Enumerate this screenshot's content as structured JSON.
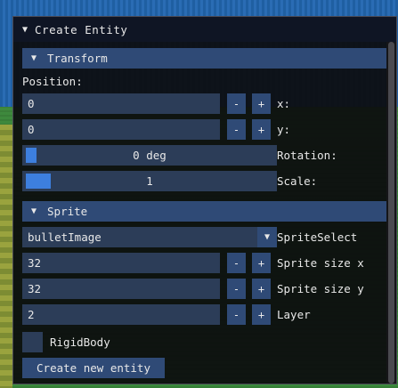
{
  "window": {
    "title": "Create Entity",
    "collapse_icon": "triangle-down-icon"
  },
  "transform": {
    "header": "Transform",
    "position_label": "Position:",
    "x": {
      "value": "0",
      "minus": "-",
      "plus": "+",
      "label": "x:"
    },
    "y": {
      "value": "0",
      "minus": "-",
      "plus": "+",
      "label": "y:"
    },
    "rotation": {
      "value": "0 deg",
      "label": "Rotation:",
      "fraction": 0.02
    },
    "scale": {
      "value": "1",
      "label": "Scale:",
      "fraction": 0.1
    }
  },
  "sprite": {
    "header": "Sprite",
    "select": {
      "value": "bulletImage",
      "label": "SpriteSelect"
    },
    "size_x": {
      "value": "32",
      "minus": "-",
      "plus": "+",
      "label": "Sprite size x"
    },
    "size_y": {
      "value": "32",
      "minus": "-",
      "plus": "+",
      "label": "Sprite size y"
    },
    "layer": {
      "value": "2",
      "minus": "-",
      "plus": "+",
      "label": "Layer"
    }
  },
  "rigidbody": {
    "label": "RigidBody",
    "checked": false
  },
  "create_button": "Create new entity",
  "colors": {
    "window_bg": "#0c0c0e",
    "header": "#2f4a76",
    "frame": "#2c3d58",
    "slider_grab": "#3d7fde",
    "text": "#e8e8e8"
  }
}
